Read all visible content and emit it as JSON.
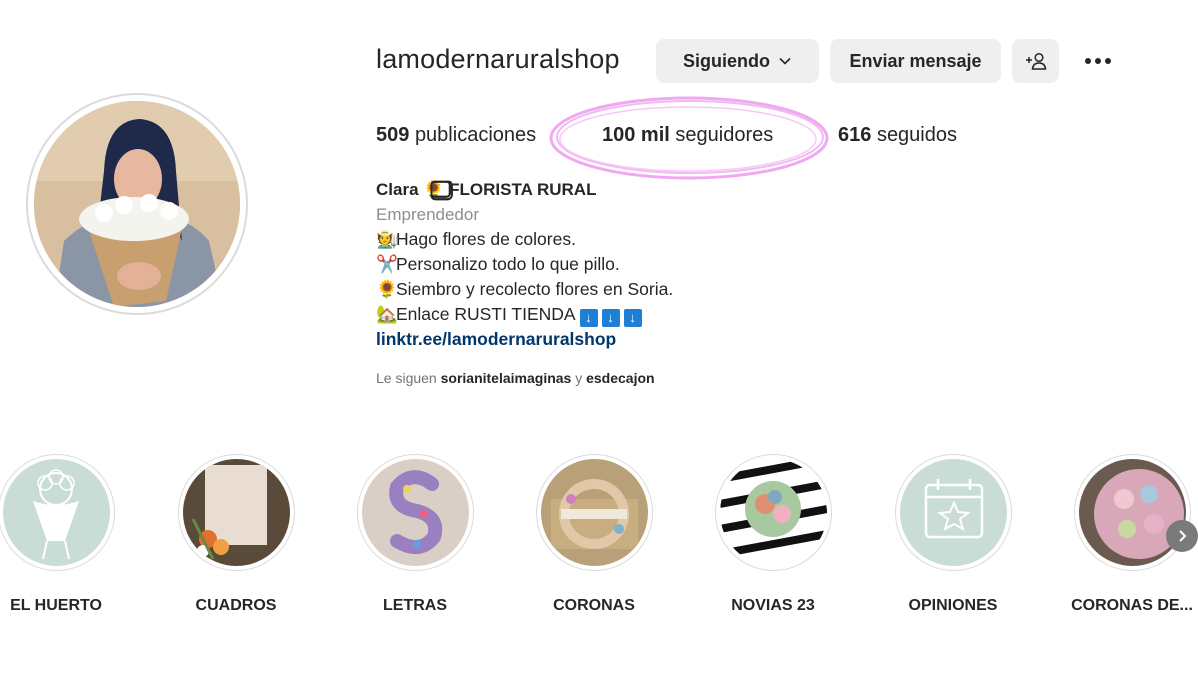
{
  "profile": {
    "username": "lamodernaruralshop",
    "buttons": {
      "following_label": "Siguiendo",
      "message_label": "Enviar mensaje"
    },
    "stats": {
      "posts_value": "509",
      "posts_label": "publicaciones",
      "followers_value": "100 mil",
      "followers_label": "seguidores",
      "following_value": "616",
      "following_label": "seguidos"
    },
    "bio": {
      "name": "Clara 🌻⃣ FLORISTA RURAL",
      "category": "Emprendedor",
      "lines": [
        "Hago flores de colores.",
        "Personalizo todo lo que pillo.",
        "Siembro y recolecto flores en Soria.",
        "Enlace RUSTI TIENDA"
      ],
      "link": "linktr.ee/lamodernaruralshop"
    },
    "followed_by": {
      "prefix": "Le siguen",
      "user1": "sorianitelaimaginas",
      "connector": "y",
      "user2": "esdecajon"
    }
  },
  "highlights": [
    {
      "label": "EL HUERTO"
    },
    {
      "label": "CUADROS"
    },
    {
      "label": "LETRAS"
    },
    {
      "label": "CORONAS"
    },
    {
      "label": "NOVIAS 23"
    },
    {
      "label": "OPINIONES"
    },
    {
      "label": "CORONAS DE..."
    }
  ],
  "icons": {
    "following_dropdown": "chevron-down-icon",
    "suggest": "add-person-icon",
    "more": "more-options-icon",
    "next": "chevron-right-icon"
  },
  "colors": {
    "button_bg": "#efefef",
    "link": "#00376b",
    "secondary_text": "#8e8e8e",
    "highlight_annotation": "#f0a8f0",
    "highlight_bg_mint": "#c9ddd6"
  }
}
